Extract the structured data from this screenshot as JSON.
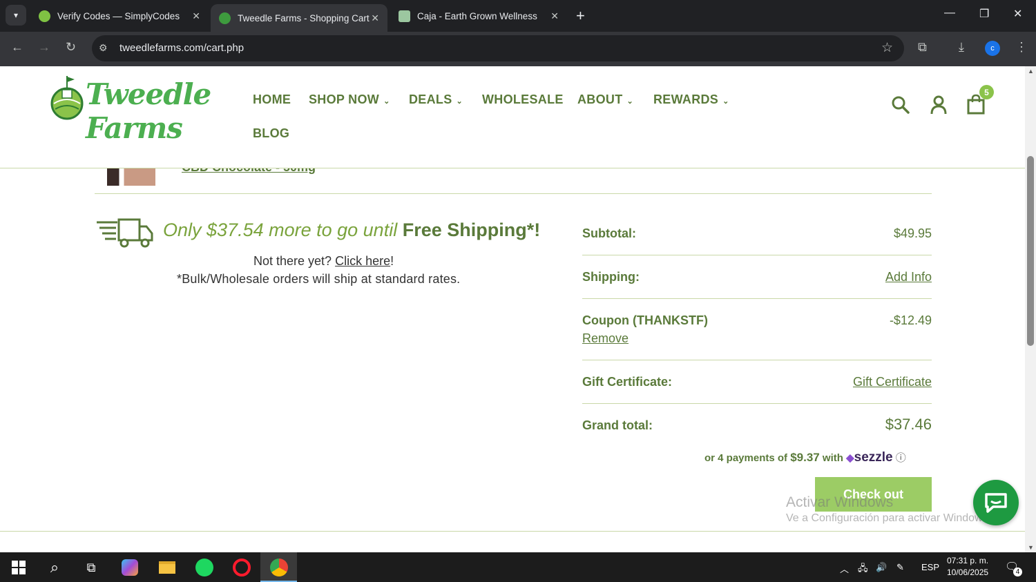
{
  "browser": {
    "tabs": [
      {
        "title": "Verify Codes — SimplyCodes",
        "active": false
      },
      {
        "title": "Tweedle Farms - Shopping Cart",
        "active": true
      },
      {
        "title": "Caja - Earth Grown Wellness",
        "active": false
      }
    ],
    "url": "tweedlefarms.com/cart.php",
    "profile_initial": "c"
  },
  "site": {
    "logo_text": "Tweedle Farms",
    "nav": {
      "home": "HOME",
      "shop_now": "SHOP NOW",
      "deals": "DEALS",
      "wholesale": "WHOLESALE",
      "about": "ABOUT",
      "rewards": "REWARDS",
      "blog": "BLOG"
    },
    "cart_count": "5"
  },
  "cart": {
    "previous_item_link": "CBD Chocolate - 50mg",
    "shipping_promo": {
      "prefix": "Only $37.54 more to go until ",
      "bold": "Free Shipping*!",
      "not_there": "Not there yet? ",
      "click_here": "Click here",
      "exclaim": "!",
      "bulk_note": "*Bulk/Wholesale orders will ship at standard rates."
    },
    "totals": {
      "subtotal_label": "Subtotal:",
      "subtotal_value": "$49.95",
      "shipping_label": "Shipping:",
      "shipping_value": "Add Info",
      "coupon_label": "Coupon (THANKSTF)",
      "coupon_value": "-$12.49",
      "coupon_remove": "Remove",
      "gift_label": "Gift Certificate:",
      "gift_value": "Gift Certificate",
      "grand_label": "Grand total:",
      "grand_value": "$37.46"
    },
    "sezzle": {
      "prefix": "or 4 payments of ",
      "amount": "$9.37",
      "with": " with ",
      "brand": "sezzle"
    },
    "checkout_label": "Check out"
  },
  "os": {
    "watermark_title": "Activar Windows",
    "watermark_sub": "Ve a Configuración para activar Windows.",
    "language": "ESP",
    "time": "07:31 p. m.",
    "date": "10/06/2025",
    "notifications": "4"
  },
  "colors": {
    "brand_green": "#5a7a3a",
    "accent_green": "#7aa33c",
    "button_green": "#9ccc65",
    "chat_green": "#1e9a41"
  }
}
